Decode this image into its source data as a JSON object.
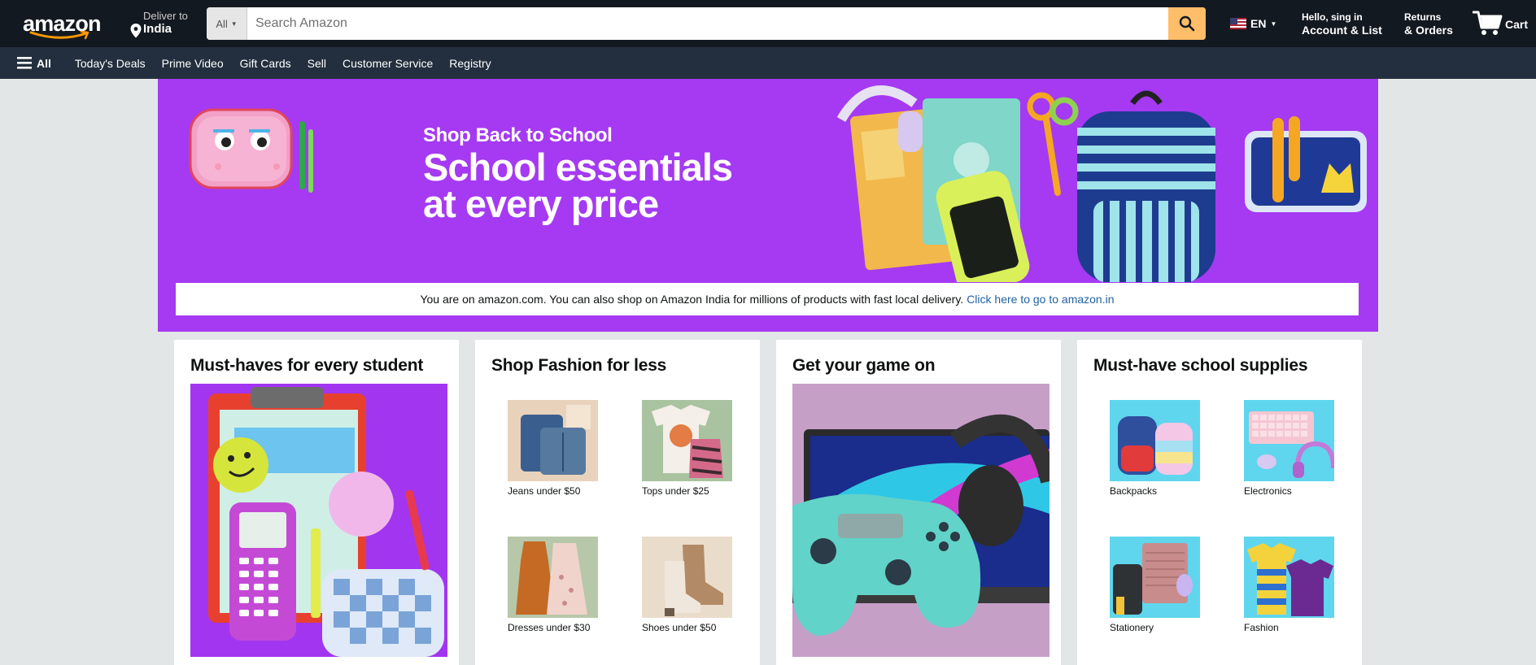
{
  "header": {
    "logo": "amazon",
    "deliver": {
      "line1": "Deliver to",
      "line2": "India"
    },
    "search": {
      "category": "All",
      "placeholder": "Search Amazon"
    },
    "language": "EN",
    "account": {
      "line1": "Hello, sing in",
      "line2": "Account & List"
    },
    "orders": {
      "line1": "Returns",
      "line2": "& Orders"
    },
    "cart": "Cart"
  },
  "subnav": {
    "all": "All",
    "links": [
      "Today's Deals",
      "Prime Video",
      "Gift Cards",
      "Sell",
      "Customer Service",
      "Registry"
    ]
  },
  "hero": {
    "kicker": "Shop Back to School",
    "headline": "School essentials at every price",
    "notice_text": "You are on amazon.com. You can also shop on Amazon India for millions of products with fast local delivery.",
    "notice_link": "Click here to go to amazon.in"
  },
  "cards": [
    {
      "title": "Must-haves for every student"
    },
    {
      "title": "Shop Fashion for less",
      "items": [
        "Jeans under $50",
        "Tops under $25",
        "Dresses under $30",
        "Shoes under $50"
      ]
    },
    {
      "title": "Get your game on"
    },
    {
      "title": "Must-have school supplies",
      "items": [
        "Backpacks",
        "Electronics",
        "Stationery",
        "Fashion"
      ]
    }
  ],
  "colors": {
    "nav_top": "#131921",
    "nav_sub": "#232f3e",
    "search_button": "#febd69",
    "hero_bg": "#a53af2",
    "link": "#2162a1"
  }
}
